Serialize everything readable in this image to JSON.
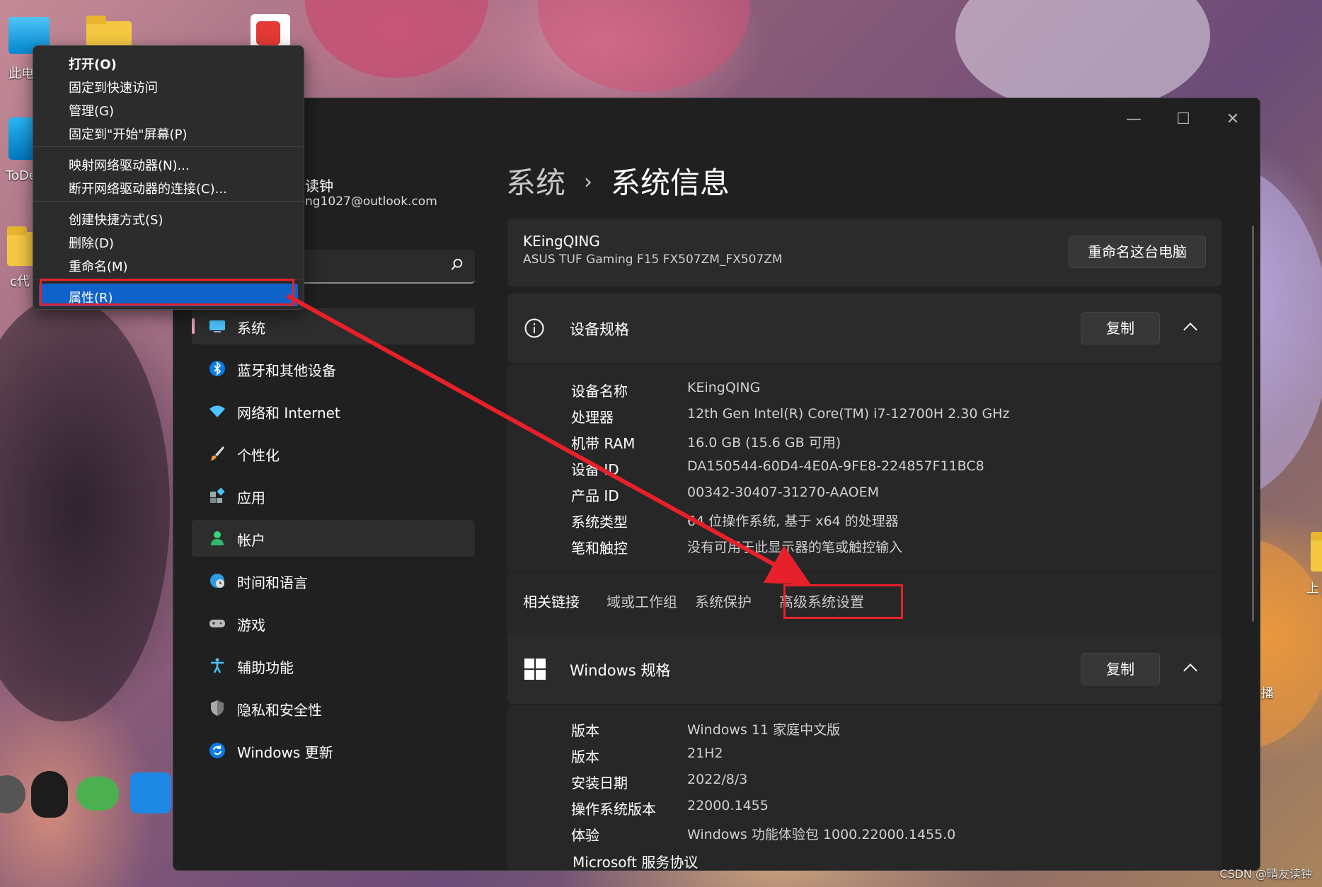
{
  "desktop": {
    "icons": [
      {
        "name": "this-pc",
        "label": "此电"
      },
      {
        "name": "todesk",
        "label": "ToDe"
      },
      {
        "name": "c-folder",
        "label": "c代"
      }
    ],
    "right_labels": [
      "上",
      "播"
    ],
    "watermark": "CSDN @晴友读钟"
  },
  "context_menu": {
    "items": [
      {
        "label": "打开(O)",
        "bold": true
      },
      {
        "label": "固定到快速访问"
      },
      {
        "label": "管理(G)"
      },
      {
        "label": "固定到\"开始\"屏幕(P)"
      },
      {
        "label": "映射网络驱动器(N)..."
      },
      {
        "label": "断开网络驱动器的连接(C)..."
      },
      {
        "label": "创建快捷方式(S)"
      },
      {
        "label": "删除(D)"
      },
      {
        "label": "重命名(M)"
      },
      {
        "label": "属性(R)",
        "selected": true
      }
    ]
  },
  "window": {
    "controls": {
      "minimize": "—",
      "maximize": "☐",
      "close": "✕"
    },
    "user": {
      "name": "读钟",
      "email": "ng1027@outlook.com"
    },
    "search": {
      "placeholder": ""
    },
    "nav": [
      {
        "label": "系统",
        "icon": "monitor-icon",
        "active": true
      },
      {
        "label": "蓝牙和其他设备",
        "icon": "bluetooth-icon"
      },
      {
        "label": "网络和 Internet",
        "icon": "wifi-icon"
      },
      {
        "label": "个性化",
        "icon": "brush-icon"
      },
      {
        "label": "应用",
        "icon": "apps-icon"
      },
      {
        "label": "帐户",
        "icon": "person-icon",
        "hover": true
      },
      {
        "label": "时间和语言",
        "icon": "globe-clock-icon"
      },
      {
        "label": "游戏",
        "icon": "gamepad-icon"
      },
      {
        "label": "辅助功能",
        "icon": "accessibility-icon"
      },
      {
        "label": "隐私和安全性",
        "icon": "shield-icon"
      },
      {
        "label": "Windows 更新",
        "icon": "update-icon"
      }
    ],
    "breadcrumb": {
      "parent": "系统",
      "separator": "›",
      "current": "系统信息"
    },
    "pc_card": {
      "name": "KEingQING",
      "model": "ASUS TUF Gaming F15 FX507ZM_FX507ZM",
      "rename_button": "重命名这台电脑"
    },
    "device_specs": {
      "title": "设备规格",
      "copy_button": "复制",
      "rows": [
        {
          "label": "设备名称",
          "value": "KEingQING"
        },
        {
          "label": "处理器",
          "value": "12th Gen Intel(R) Core(TM) i7-12700H   2.30 GHz"
        },
        {
          "label": "机带 RAM",
          "value": "16.0 GB (15.6 GB 可用)"
        },
        {
          "label": "设备 ID",
          "value": "DA150544-60D4-4E0A-9FE8-224857F11BC8"
        },
        {
          "label": "产品 ID",
          "value": "00342-30407-31270-AAOEM"
        },
        {
          "label": "系统类型",
          "value": "64 位操作系统, 基于 x64 的处理器"
        },
        {
          "label": "笔和触控",
          "value": "没有可用于此显示器的笔或触控输入"
        }
      ]
    },
    "related_links": {
      "title": "相关链接",
      "links": [
        "域或工作组",
        "系统保护",
        "高级系统设置"
      ]
    },
    "windows_specs": {
      "title": "Windows 规格",
      "copy_button": "复制",
      "rows": [
        {
          "label": "版本",
          "value": "Windows 11 家庭中文版"
        },
        {
          "label": "版本",
          "value": "21H2"
        },
        {
          "label": "安装日期",
          "value": "2022/8/3"
        },
        {
          "label": "操作系统版本",
          "value": "22000.1455"
        },
        {
          "label": "体验",
          "value": "Windows 功能体验包 1000.22000.1455.0"
        }
      ],
      "link": "Microsoft 服务协议"
    }
  },
  "colors": {
    "accent_red": "#e8202a",
    "selection_blue": "#0e62c8",
    "window_bg": "#202020",
    "card_bg": "#2b2b2b"
  }
}
